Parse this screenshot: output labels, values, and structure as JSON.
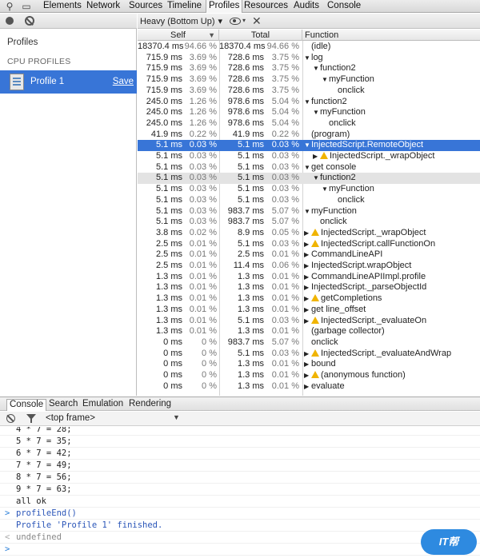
{
  "toolbar": {
    "tabs": [
      "Elements",
      "Network",
      "Sources",
      "Timeline",
      "Profiles",
      "Resources",
      "Audits",
      "Console"
    ],
    "active": "Profiles"
  },
  "sidebar": {
    "heading": "Profiles",
    "section": "CPU PROFILES",
    "profile_name": "Profile 1",
    "save_label": "Save"
  },
  "main": {
    "view_select": "Heavy (Bottom Up)",
    "columns": {
      "self": "Self",
      "total": "Total",
      "function": "Function"
    },
    "rows": [
      {
        "self": "18370.4 ms",
        "selfp": "94.66 %",
        "total": "18370.4 ms",
        "totalp": "94.66 %",
        "depth": 0,
        "tri": "",
        "warn": false,
        "func": "(idle)"
      },
      {
        "self": "715.9 ms",
        "selfp": "3.69 %",
        "total": "728.6 ms",
        "totalp": "3.75 %",
        "depth": 0,
        "tri": "▼",
        "warn": false,
        "func": "log"
      },
      {
        "self": "715.9 ms",
        "selfp": "3.69 %",
        "total": "728.6 ms",
        "totalp": "3.75 %",
        "depth": 1,
        "tri": "▼",
        "warn": false,
        "func": "function2"
      },
      {
        "self": "715.9 ms",
        "selfp": "3.69 %",
        "total": "728.6 ms",
        "totalp": "3.75 %",
        "depth": 2,
        "tri": "▼",
        "warn": false,
        "func": "myFunction"
      },
      {
        "self": "715.9 ms",
        "selfp": "3.69 %",
        "total": "728.6 ms",
        "totalp": "3.75 %",
        "depth": 3,
        "tri": "",
        "warn": false,
        "func": "onclick"
      },
      {
        "self": "245.0 ms",
        "selfp": "1.26 %",
        "total": "978.6 ms",
        "totalp": "5.04 %",
        "depth": 0,
        "tri": "▼",
        "warn": false,
        "func": "function2"
      },
      {
        "self": "245.0 ms",
        "selfp": "1.26 %",
        "total": "978.6 ms",
        "totalp": "5.04 %",
        "depth": 1,
        "tri": "▼",
        "warn": false,
        "func": "myFunction"
      },
      {
        "self": "245.0 ms",
        "selfp": "1.26 %",
        "total": "978.6 ms",
        "totalp": "5.04 %",
        "depth": 2,
        "tri": "",
        "warn": false,
        "func": "onclick"
      },
      {
        "self": "41.9 ms",
        "selfp": "0.22 %",
        "total": "41.9 ms",
        "totalp": "0.22 %",
        "depth": 0,
        "tri": "",
        "warn": false,
        "func": "(program)"
      },
      {
        "self": "5.1 ms",
        "selfp": "0.03 %",
        "total": "5.1 ms",
        "totalp": "0.03 %",
        "depth": 0,
        "tri": "▼",
        "warn": false,
        "func": "InjectedScript.RemoteObject",
        "state": "selected"
      },
      {
        "self": "5.1 ms",
        "selfp": "0.03 %",
        "total": "5.1 ms",
        "totalp": "0.03 %",
        "depth": 1,
        "tri": "▶",
        "warn": true,
        "func": "InjectedScript._wrapObject"
      },
      {
        "self": "5.1 ms",
        "selfp": "0.03 %",
        "total": "5.1 ms",
        "totalp": "0.03 %",
        "depth": 0,
        "tri": "▼",
        "warn": false,
        "func": "get console"
      },
      {
        "self": "5.1 ms",
        "selfp": "0.03 %",
        "total": "5.1 ms",
        "totalp": "0.03 %",
        "depth": 1,
        "tri": "▼",
        "warn": false,
        "func": "function2",
        "state": "hover"
      },
      {
        "self": "5.1 ms",
        "selfp": "0.03 %",
        "total": "5.1 ms",
        "totalp": "0.03 %",
        "depth": 2,
        "tri": "▼",
        "warn": false,
        "func": "myFunction"
      },
      {
        "self": "5.1 ms",
        "selfp": "0.03 %",
        "total": "5.1 ms",
        "totalp": "0.03 %",
        "depth": 3,
        "tri": "",
        "warn": false,
        "func": "onclick"
      },
      {
        "self": "5.1 ms",
        "selfp": "0.03 %",
        "total": "983.7 ms",
        "totalp": "5.07 %",
        "depth": 0,
        "tri": "▼",
        "warn": false,
        "func": "myFunction"
      },
      {
        "self": "5.1 ms",
        "selfp": "0.03 %",
        "total": "983.7 ms",
        "totalp": "5.07 %",
        "depth": 1,
        "tri": "",
        "warn": false,
        "func": "onclick"
      },
      {
        "self": "3.8 ms",
        "selfp": "0.02 %",
        "total": "8.9 ms",
        "totalp": "0.05 %",
        "depth": 0,
        "tri": "▶",
        "warn": true,
        "func": "InjectedScript._wrapObject"
      },
      {
        "self": "2.5 ms",
        "selfp": "0.01 %",
        "total": "5.1 ms",
        "totalp": "0.03 %",
        "depth": 0,
        "tri": "▶",
        "warn": true,
        "func": "InjectedScript.callFunctionOn"
      },
      {
        "self": "2.5 ms",
        "selfp": "0.01 %",
        "total": "2.5 ms",
        "totalp": "0.01 %",
        "depth": 0,
        "tri": "▶",
        "warn": false,
        "func": "CommandLineAPI"
      },
      {
        "self": "2.5 ms",
        "selfp": "0.01 %",
        "total": "11.4 ms",
        "totalp": "0.06 %",
        "depth": 0,
        "tri": "▶",
        "warn": false,
        "func": "InjectedScript.wrapObject"
      },
      {
        "self": "1.3 ms",
        "selfp": "0.01 %",
        "total": "1.3 ms",
        "totalp": "0.01 %",
        "depth": 0,
        "tri": "▶",
        "warn": false,
        "func": "CommandLineAPIImpl.profile"
      },
      {
        "self": "1.3 ms",
        "selfp": "0.01 %",
        "total": "1.3 ms",
        "totalp": "0.01 %",
        "depth": 0,
        "tri": "▶",
        "warn": false,
        "func": "InjectedScript._parseObjectId"
      },
      {
        "self": "1.3 ms",
        "selfp": "0.01 %",
        "total": "1.3 ms",
        "totalp": "0.01 %",
        "depth": 0,
        "tri": "▶",
        "warn": true,
        "func": "getCompletions"
      },
      {
        "self": "1.3 ms",
        "selfp": "0.01 %",
        "total": "1.3 ms",
        "totalp": "0.01 %",
        "depth": 0,
        "tri": "▶",
        "warn": false,
        "func": "get line_offset"
      },
      {
        "self": "1.3 ms",
        "selfp": "0.01 %",
        "total": "5.1 ms",
        "totalp": "0.03 %",
        "depth": 0,
        "tri": "▶",
        "warn": true,
        "func": "InjectedScript._evaluateOn"
      },
      {
        "self": "1.3 ms",
        "selfp": "0.01 %",
        "total": "1.3 ms",
        "totalp": "0.01 %",
        "depth": 0,
        "tri": "",
        "warn": false,
        "func": "(garbage collector)"
      },
      {
        "self": "0 ms",
        "selfp": "0 %",
        "total": "983.7 ms",
        "totalp": "5.07 %",
        "depth": 0,
        "tri": "",
        "warn": false,
        "func": "onclick"
      },
      {
        "self": "0 ms",
        "selfp": "0 %",
        "total": "5.1 ms",
        "totalp": "0.03 %",
        "depth": 0,
        "tri": "▶",
        "warn": true,
        "func": "InjectedScript._evaluateAndWrap"
      },
      {
        "self": "0 ms",
        "selfp": "0 %",
        "total": "1.3 ms",
        "totalp": "0.01 %",
        "depth": 0,
        "tri": "▶",
        "warn": false,
        "func": "bound"
      },
      {
        "self": "0 ms",
        "selfp": "0 %",
        "total": "1.3 ms",
        "totalp": "0.01 %",
        "depth": 0,
        "tri": "▶",
        "warn": true,
        "func": "(anonymous function)"
      },
      {
        "self": "0 ms",
        "selfp": "0 %",
        "total": "1.3 ms",
        "totalp": "0.01 %",
        "depth": 0,
        "tri": "▶",
        "warn": false,
        "func": "evaluate"
      }
    ]
  },
  "drawer": {
    "tabs": [
      "Console",
      "Search",
      "Emulation",
      "Rendering"
    ],
    "active": "Console",
    "frame": "<top frame>"
  },
  "console": {
    "lines": [
      {
        "text": "4 * 7 = 28;",
        "kind": "log",
        "prompt": ""
      },
      {
        "text": "5 * 7 = 35;",
        "kind": "log",
        "prompt": ""
      },
      {
        "text": "6 * 7 = 42;",
        "kind": "log",
        "prompt": ""
      },
      {
        "text": "7 * 7 = 49;",
        "kind": "log",
        "prompt": ""
      },
      {
        "text": "8 * 7 = 56;",
        "kind": "log",
        "prompt": ""
      },
      {
        "text": "9 * 7 = 63;",
        "kind": "log",
        "prompt": ""
      },
      {
        "text": "all ok",
        "kind": "log",
        "prompt": ""
      },
      {
        "text": "profileEnd()",
        "kind": "cmd",
        "prompt": ">"
      },
      {
        "text": "Profile 'Profile 1' finished.",
        "kind": "info",
        "prompt": ""
      },
      {
        "text": "undefined",
        "kind": "result",
        "prompt": "<"
      },
      {
        "text": "",
        "kind": "cmd",
        "prompt": ">"
      }
    ]
  },
  "watermark": "IT帮"
}
